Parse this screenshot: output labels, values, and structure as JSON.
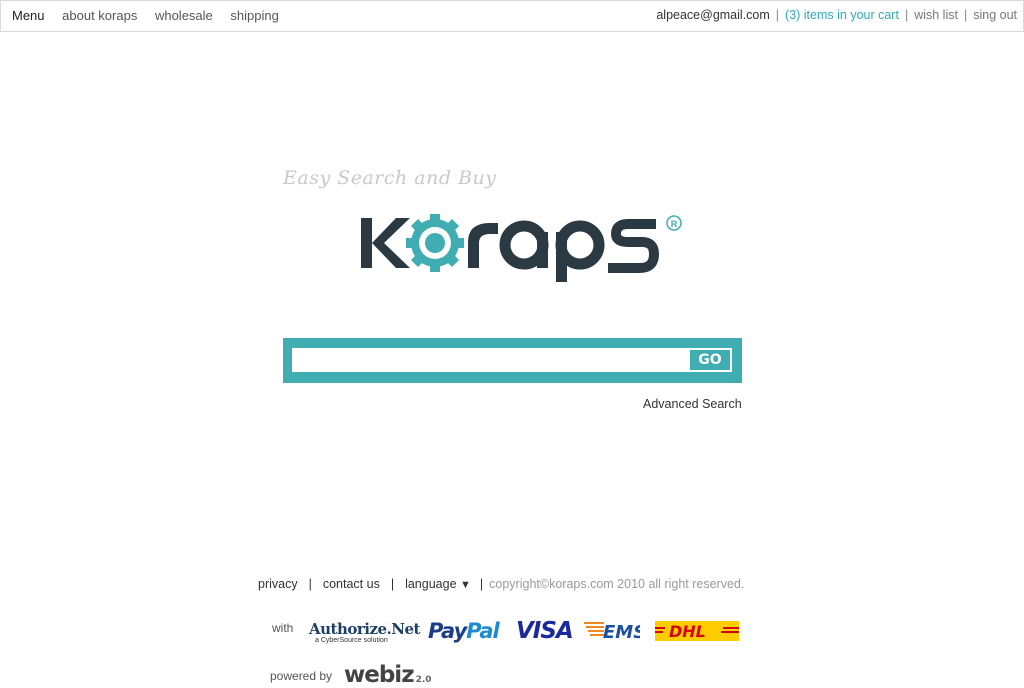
{
  "topbar": {
    "menu": "Menu",
    "nav": [
      "about koraps",
      "wholesale",
      "shipping"
    ],
    "email": "alpeace@gmail.com",
    "cart": "(3) items in your cart",
    "wishlist": "wish list",
    "signout": "sing out",
    "separator": "|"
  },
  "hero": {
    "tagline": "Easy Search and Buy",
    "logo_text": "Koraps",
    "registered": "®"
  },
  "search": {
    "placeholder": "",
    "go_label": "GO",
    "advanced": "Advanced Search"
  },
  "footer": {
    "privacy": "privacy",
    "contact": "contact us",
    "language": "language",
    "language_arrow": "▼",
    "copyright": "copyright©koraps.com 2010 all right reserved.",
    "with": "with",
    "payments": {
      "authorize_main": "Authorize.Net",
      "authorize_sub": "a CyberSource solution",
      "paypal_a": "Pay",
      "paypal_b": "Pal",
      "visa": "VISA",
      "ems": "EMS",
      "dhl": "DHL"
    },
    "powered_by": "powered by",
    "webiz": "webiz",
    "webiz_version": "2.0"
  },
  "colors": {
    "accent": "#3fadb1",
    "cart_link": "#35a8b6",
    "logo_dark": "#2b3a42",
    "logo_teal": "#3fadb1"
  }
}
